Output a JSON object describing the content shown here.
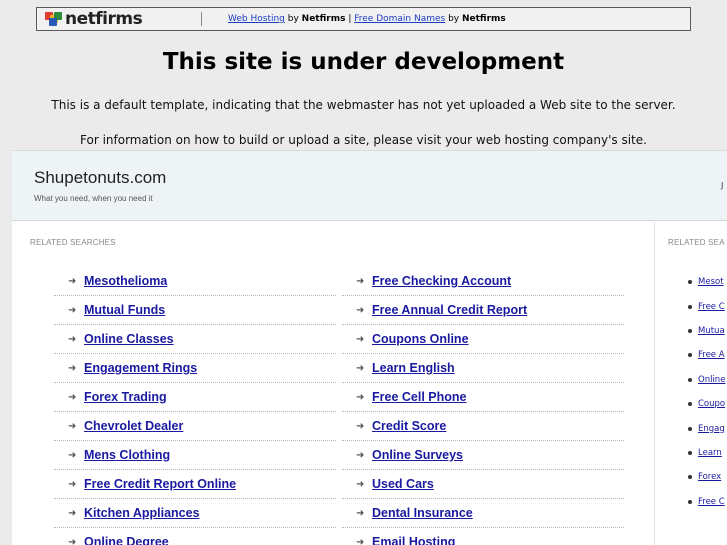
{
  "topbar": {
    "logo_text": "netfirms",
    "link1": "Web Hosting",
    "by1": " by ",
    "brand1": "Netfirms",
    "sep": " | ",
    "link2": "Free Domain Names",
    "by2": " by ",
    "brand2": "Netfirms"
  },
  "headline": "This site is under development",
  "notice1": "This is a default template, indicating that the webmaster has not yet uploaded a Web site to the server.",
  "notice2": "For information on how to build or upload a site, please visit your web hosting company's site.",
  "parked": {
    "site_title": "Shupetonuts.com",
    "tagline": "What you need, when you need it",
    "head_right": "J",
    "main_label": "RELATED SEARCHES",
    "side_label": "RELATED SEA",
    "left_links": [
      "Mesothelioma",
      "Mutual Funds",
      "Online Classes",
      "Engagement Rings",
      "Forex Trading",
      "Chevrolet Dealer",
      "Mens Clothing",
      "Free Credit Report Online",
      "Kitchen Appliances",
      "Online Degree"
    ],
    "right_links": [
      "Free Checking Account",
      "Free Annual Credit Report",
      "Coupons Online",
      "Learn English",
      "Free Cell Phone",
      "Credit Score",
      "Online Surveys",
      "Used Cars",
      "Dental Insurance",
      "Email Hosting"
    ],
    "side_links": [
      "Mesot",
      "Free C",
      "Mutua",
      "Free A",
      "Online",
      "Coupo",
      "Engag",
      "Learn",
      "Forex",
      "Free C"
    ]
  },
  "colors": {
    "link": "#1a1aa0",
    "topbar_link": "#1a3cc4",
    "header_bg": "#eef3f6",
    "page_bg": "#ebebeb"
  },
  "icons": {
    "list_bullet": "arrow-right-icon",
    "side_bullet": "dot-icon",
    "logo": "netfirms-logo-icon"
  }
}
